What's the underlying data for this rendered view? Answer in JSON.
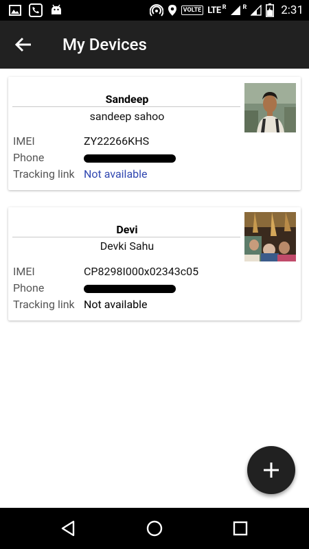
{
  "status_bar": {
    "left_icons": [
      "image-icon",
      "phone-call-icon",
      "android-icon"
    ],
    "network_label": "VOLTE",
    "lte_label": "LTE",
    "roaming_label_1": "R",
    "roaming_label_2": "R",
    "time": "2:31"
  },
  "app_bar": {
    "title": "My Devices",
    "back_icon": "arrow-back-icon"
  },
  "devices": [
    {
      "name": "Sandeep",
      "full_name": "sandeep sahoo",
      "imei_label": "IMEI",
      "imei": "ZY22266KHS",
      "phone_label": "Phone",
      "tracking_label": "Tracking link",
      "tracking_value": "Not available"
    },
    {
      "name": "Devi",
      "full_name": "Devki Sahu",
      "imei_label": "IMEI",
      "imei": "CP8298I000x02343c05",
      "phone_label": "Phone",
      "tracking_label": "Tracking link",
      "tracking_value": "Not available"
    }
  ],
  "fab": {
    "icon": "plus-icon"
  },
  "nav_bar": {
    "icons": [
      "back-triangle-icon",
      "home-circle-icon",
      "recents-square-icon"
    ]
  },
  "colors": {
    "app_bar": "#212121",
    "link": "#2f46b0",
    "fab": "#212121"
  }
}
